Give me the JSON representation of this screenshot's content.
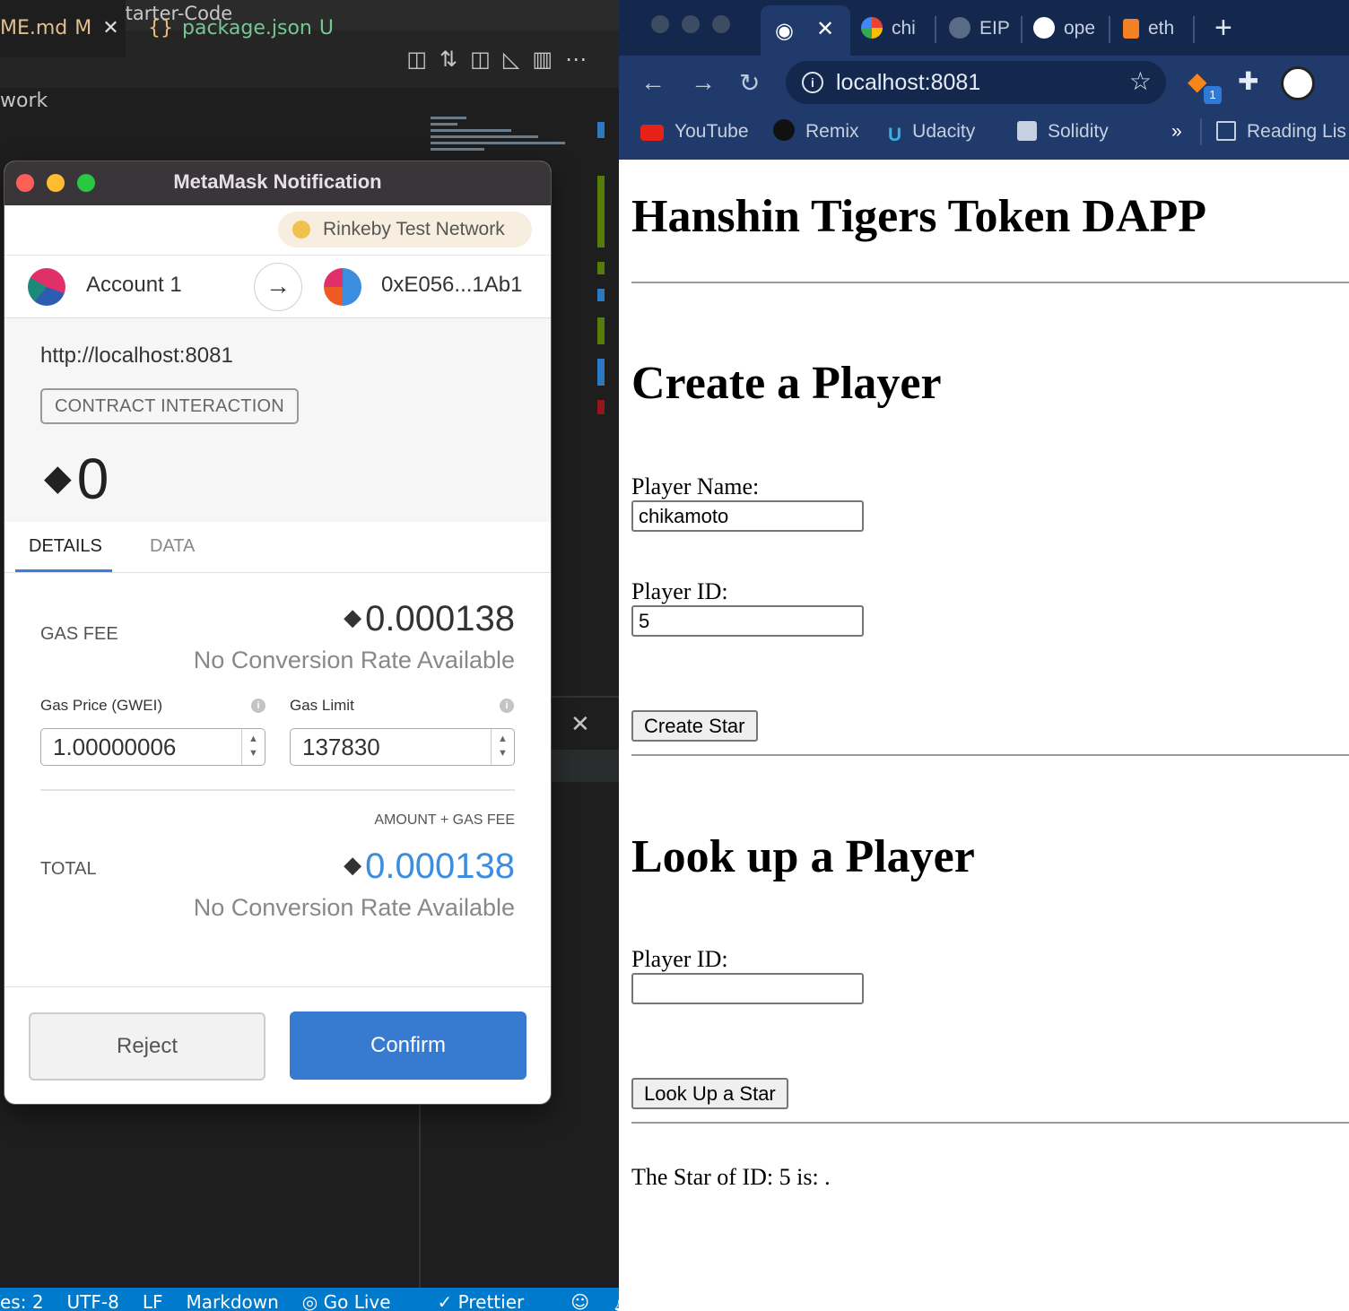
{
  "vscode": {
    "title": "ary-Service-Starter-Code",
    "tabs": [
      {
        "label": "ME.md",
        "status": "M"
      },
      {
        "label": "package.json",
        "status": "U"
      }
    ],
    "tab_icon_braces": "{}",
    "breadcrumb": "work",
    "status_bar": [
      "es: 2",
      "UTF-8",
      "LF",
      "Markdown",
      "Go Live",
      "Prettier"
    ]
  },
  "metamask": {
    "window_title": "MetaMask Notification",
    "network": "Rinkeby Test Network",
    "from_account": "Account 1",
    "to_address": "0xE056...1Ab1",
    "origin": "http://localhost:8081",
    "badge": "CONTRACT INTERACTION",
    "amount": "0",
    "tabs": [
      "DETAILS",
      "DATA"
    ],
    "gas_fee_label": "GAS FEE",
    "gas_fee_value": "0.000138",
    "no_conversion": "No Conversion Rate Available",
    "gas_price_label": "Gas Price (GWEI)",
    "gas_price_value": "1.00000006",
    "gas_limit_label": "Gas Limit",
    "gas_limit_value": "137830",
    "amount_gas_label": "AMOUNT + GAS FEE",
    "total_label": "TOTAL",
    "total_value": "0.000138",
    "reject_label": "Reject",
    "confirm_label": "Confirm"
  },
  "chrome": {
    "tabs": [
      "chi",
      "EIP",
      "ope",
      "eth"
    ],
    "url": "localhost:8081",
    "bookmarks": [
      "YouTube",
      "Remix",
      "Udacity",
      "Solidity"
    ],
    "more_bookmarks": "»",
    "reading_list": "Reading Lis",
    "ext_badge": "1"
  },
  "page": {
    "title": "Hanshin Tigers Token DAPP",
    "create_heading": "Create a Player",
    "player_name_label": "Player Name:",
    "player_name_value": "chikamoto",
    "player_id_label": "Player ID:",
    "player_id_value": "5",
    "create_button": "Create Star",
    "lookup_heading": "Look up a Player",
    "lookup_id_label": "Player ID:",
    "lookup_id_value": "",
    "lookup_button": "Look Up a Star",
    "result_text": "The Star of ID: 5 is: ."
  },
  "colors": {
    "vscode_status": "#007acc",
    "confirm_blue": "#377bd0",
    "total_blue": "#3b8de0",
    "chrome_toolbar": "#1f3a6b"
  }
}
